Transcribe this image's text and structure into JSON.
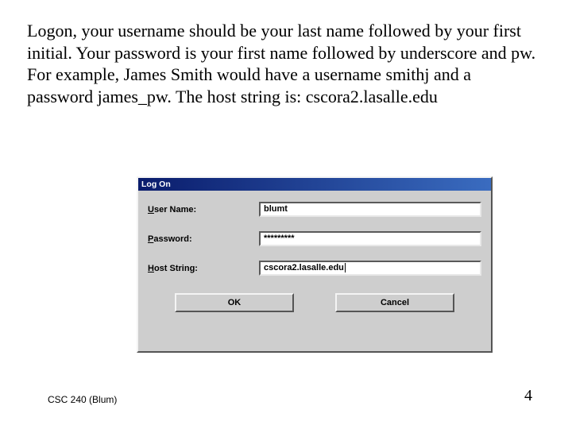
{
  "instructions": "Logon, your username should be your last name followed by your first initial. Your password is your first name followed by underscore and pw.  For example, James Smith would have a username smithj and a password james_pw. The host string is: cscora2.lasalle.edu",
  "dialog": {
    "title": "Log On",
    "username_label_prefix": "U",
    "username_label_rest": "ser Name:",
    "username_value": "blumt",
    "password_label_prefix": "P",
    "password_label_rest": "assword:",
    "password_value": "*********",
    "host_label_prefix": "H",
    "host_label_rest": "ost String:",
    "host_value": "cscora2.lasalle.edu",
    "ok_label": "OK",
    "cancel_label": "Cancel"
  },
  "footer": {
    "left": "CSC 240 (Blum)",
    "page": "4"
  }
}
